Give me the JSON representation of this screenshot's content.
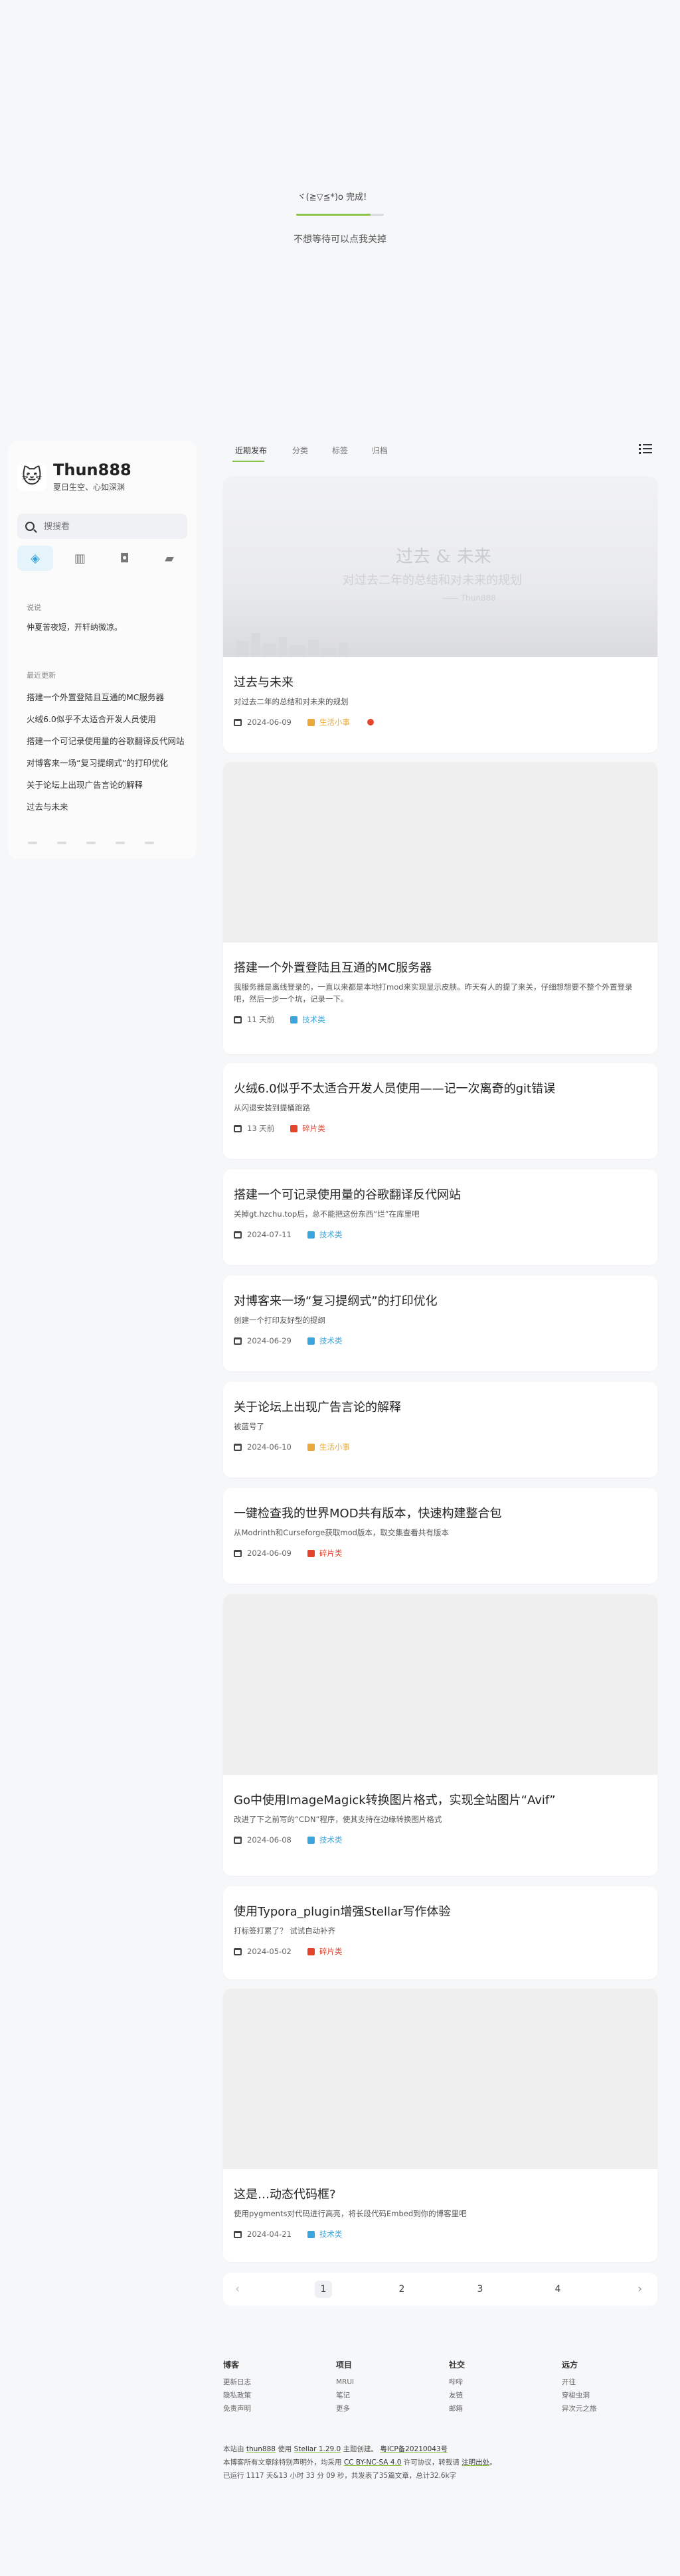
{
  "loader": {
    "title": "ヾ(≧▽≦*)o 完成!",
    "progress_percent": 85,
    "hint": "不想等待可以点我关掉"
  },
  "sidebar": {
    "brand_title": "Thun888",
    "brand_subtitle": "夏日生空、心如深渊",
    "avatar_icon": "cat-avatar",
    "search_placeholder": "搜搜看",
    "quick_links": [
      {
        "icon": "cube-icon",
        "glyph": "◈"
      },
      {
        "icon": "book-icon",
        "glyph": "▥"
      },
      {
        "icon": "chat-icon",
        "glyph": "◘"
      },
      {
        "icon": "eraser-icon",
        "glyph": "▰"
      }
    ],
    "moment_heading": "说说",
    "moment_text": "仲夏苦夜短，开轩纳微凉。",
    "recent_heading": "最近更新",
    "recent_items": [
      "搭建一个外置登陆且互通的MC服务器",
      "火绒6.0似乎不太适合开发人员使用",
      "搭建一个可记录使用量的谷歌翻译反代网站",
      "对博客来一场“复习提纲式”的打印优化",
      "关于论坛上出现广告言论的解释",
      "过去与未来"
    ]
  },
  "tabs": [
    "近期发布",
    "分类",
    "标签",
    "归档"
  ],
  "posts": [
    {
      "title": "过去与未来",
      "excerpt": "对过去二年的总结和对未来的规划",
      "date": "2024-06-09",
      "category": "生活小事",
      "cat_color": "#e9a93b",
      "cover": true,
      "cover_t1": "过去 & 未来",
      "cover_t2": "对过去二年的总结和对未来的规划",
      "cover_t3": "—— Thun888"
    },
    {
      "title": "搭建一个外置登陆且互通的MC服务器",
      "excerpt": "我服务器是离线登录的，一直以来都是本地打mod来实现显示皮肤。昨天有人的提了来关，仔细想想要不整个外置登录吧，然后一步一个坑，记录一下。",
      "date": "11 天前",
      "category": "技术类",
      "cat_color": "#3ba6dd",
      "cover": true
    },
    {
      "title": "火绒6.0似乎不太适合开发人员使用——记一次离奇的git错误",
      "excerpt": "从闪退安装到提桶跑路",
      "date": "13 天前",
      "category": "碎片类",
      "cat_color": "#e2452c",
      "cover": false
    },
    {
      "title": "搭建一个可记录使用量的谷歌翻译反代网站",
      "excerpt": "关掉gt.hzchu.top后，总不能把这份东西“烂”在库里吧",
      "date": "2024-07-11",
      "category": "技术类",
      "cat_color": "#3ba6dd",
      "cover": false
    },
    {
      "title": "对博客来一场“复习提纲式”的打印优化",
      "excerpt": "创建一个打印友好型的提纲",
      "date": "2024-06-29",
      "category": "技术类",
      "cat_color": "#3ba6dd",
      "cover": false
    },
    {
      "title": "关于论坛上出现广告言论的解释",
      "excerpt": "被蓝号了",
      "date": "2024-06-10",
      "category": "生活小事",
      "cat_color": "#e9a93b",
      "cover": false
    },
    {
      "title": "一键检查我的世界MOD共有版本，快速构建整合包",
      "excerpt": "从Modrinth和Curseforge获取mod版本，取交集查看共有版本",
      "date": "2024-06-09",
      "category": "碎片类",
      "cat_color": "#e2452c",
      "cover": false
    },
    {
      "title": "Go中使用ImageMagick转换图片格式，实现全站图片“Avif”",
      "excerpt": "改进了下之前写的“CDN”程序，使其支持在边缘转换图片格式",
      "date": "2024-06-08",
      "category": "技术类",
      "cat_color": "#3ba6dd",
      "cover": true
    },
    {
      "title": "使用Typora_plugin增强Stellar写作体验",
      "excerpt": "打标签打累了？ 试试自动补齐",
      "date": "2024-05-02",
      "category": "碎片类",
      "cat_color": "#e2452c",
      "cover": false
    },
    {
      "title": "这是…动态代码框?",
      "excerpt": "使用pygments对代码进行高亮，将长段代码Embed到你的博客里吧",
      "date": "2024-04-21",
      "category": "技术类",
      "cat_color": "#3ba6dd",
      "cover": true
    }
  ],
  "pager": {
    "prev": "‹",
    "next": "›",
    "pages": [
      "1",
      "2",
      "3",
      "4"
    ],
    "current": "1"
  },
  "footer": {
    "columns": [
      {
        "heading": "博客",
        "links": [
          "更新日志",
          "隐私政策",
          "免责声明"
        ]
      },
      {
        "heading": "项目",
        "links": [
          "MRUI",
          "笔记",
          "更多"
        ]
      },
      {
        "heading": "社交",
        "links": [
          "哔哔",
          "友链",
          "邮箱"
        ]
      },
      {
        "heading": "远方",
        "links": [
          "开往",
          "穿梭虫洞",
          "异次元之旅"
        ]
      }
    ],
    "line1_a": "本站由",
    "line1_owner": "thun888",
    "line1_b": "使用",
    "line1_theme": "Stellar 1.29.0",
    "line1_c": "主题创建。",
    "line1_icp": "粤ICP备20210043号",
    "line2_a": "本博客所有文章除特别声明外，均采用",
    "line2_license": "CC BY-NC-SA 4.0",
    "line2_b": "许可协议，转载请",
    "line2_note": "注明出处",
    "line2_c": "。",
    "line3": "已运行 1117 天&13 小时 33 分 09 秒，共发表了35篇文章，总计32.6k字"
  }
}
